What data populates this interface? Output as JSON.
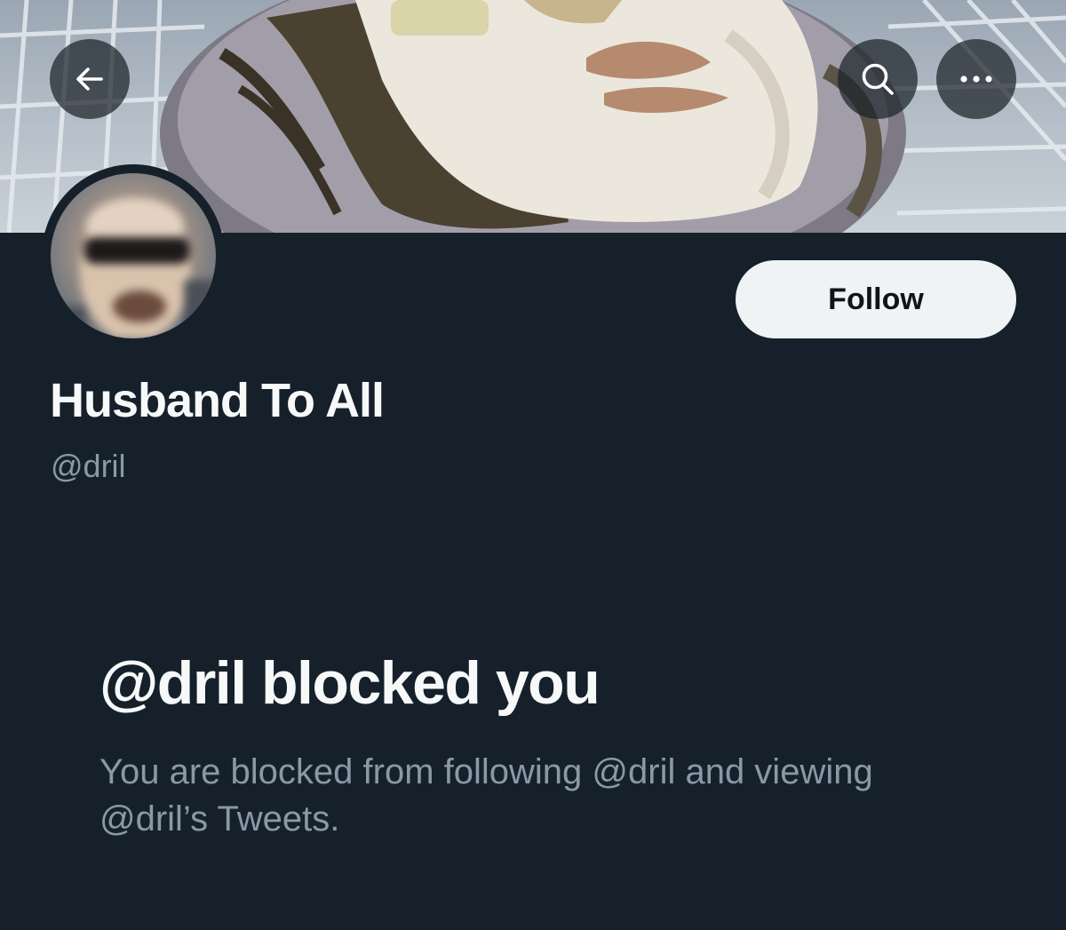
{
  "header": {
    "back_icon": "arrow-left-icon",
    "search_icon": "search-icon",
    "more_icon": "more-horizontal-icon"
  },
  "profile": {
    "display_name": "Husband To All",
    "handle": "@dril",
    "follow_label": "Follow"
  },
  "blocked": {
    "title": "@dril blocked you",
    "description": "You are blocked from following @dril and viewing @dril’s Tweets."
  },
  "colors": {
    "background": "#15202b",
    "primary_text": "#f7f9f9",
    "secondary_text": "#8b98a5",
    "follow_button_bg": "#eff3f4",
    "follow_button_text": "#0f1419"
  }
}
